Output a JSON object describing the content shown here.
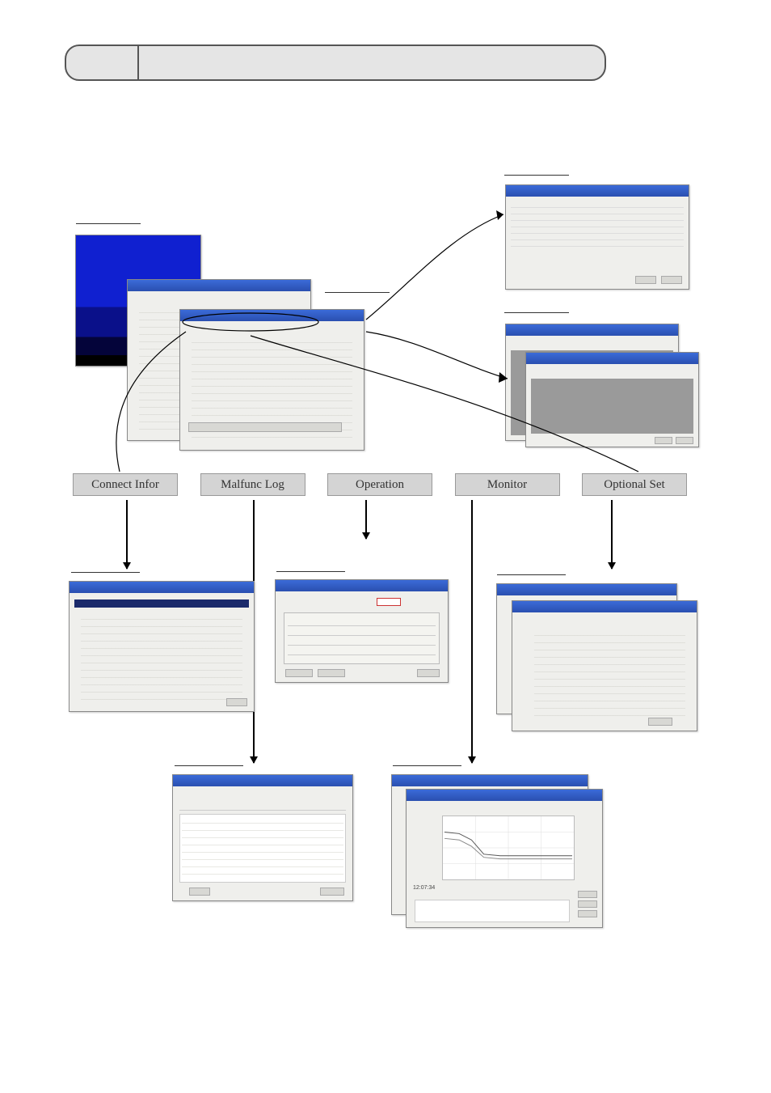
{
  "buttons": {
    "connect": "Connect Infor",
    "malfunc": "Malfunc Log",
    "operation": "Operation",
    "monitor": "Monitor",
    "optional": "Optional Set"
  },
  "labels": {
    "boot": "",
    "main": "",
    "schedule": "",
    "maint": "",
    "connect_info": "",
    "operation_ctrl": "",
    "optional_set": "",
    "malfunc_log": "",
    "monitor_display": ""
  }
}
